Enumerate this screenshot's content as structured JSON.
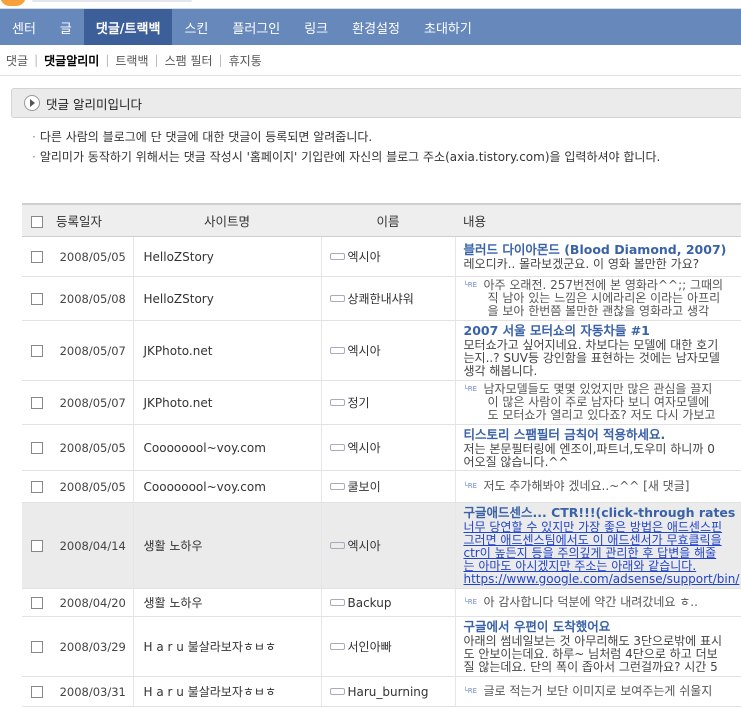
{
  "nav": {
    "main": [
      "센터",
      "글",
      "댓글/트랙백",
      "스킨",
      "플러그인",
      "링크",
      "환경설정",
      "초대하기"
    ],
    "active_main": 2,
    "sub": [
      "댓글",
      "댓글알리미",
      "트랙백",
      "스팸 필터",
      "휴지통"
    ],
    "active_sub": 1
  },
  "page": {
    "title": "댓글 알리미입니다",
    "desc": [
      "다른 사람의 블로그에 단 댓글에 대한 댓글이 등록되면 알려줍니다.",
      "알리미가 동작하기 위해서는 댓글 작성시 '홈페이지' 기입란에 자신의 블로그 주소(axia.tistory.com)을 입력하셔야 합니다."
    ]
  },
  "table": {
    "headers": {
      "date": "등록일자",
      "site": "사이트명",
      "name": "이름",
      "content": "내용"
    },
    "rows": [
      {
        "date": "2008/05/05",
        "site": "HelloZStory",
        "name": "엑시아",
        "kind": "post",
        "title": "블러드 다이아몬드 (Blood Diamond, 2007)",
        "body": [
          "레오디카.. 몰라보겠군요. 이 영화 볼만한 가요?"
        ],
        "h": 40
      },
      {
        "date": "2008/05/08",
        "site": "HelloZStory",
        "name": "상쾌한내샤워",
        "kind": "reply",
        "body": [
          "아주 오래전. 257번전에 본 영화라^^;; 그때의",
          "직 남아 있는 느낌은 시에라리온 이라는 아프리",
          "을 보아 한번쯤 볼만한 괜찮을 영화라고 생각"
        ],
        "h": 44
      },
      {
        "date": "2008/05/07",
        "site": "JKPhoto.net",
        "name": "엑시아",
        "kind": "post",
        "title": "2007 서울 모터쇼의 자동차들 #1",
        "body": [
          "모터쇼가고 싶어지네요. 차보다는 모델에 대한 호기",
          "는지..? SUV등 강인함을 표현하는 것에는 남자모델",
          "생각 해봅니다."
        ],
        "h": 60
      },
      {
        "date": "2008/05/07",
        "site": "JKPhoto.net",
        "name": "정기",
        "kind": "reply",
        "body": [
          "남자모델들도 몇몇 있었지만 많은 관심을 끌지",
          "이 많은 사람이 주로 남자다 보니 여자모델에",
          "도 모터쇼가 열리고 있다죠? 저도 다시 가보고"
        ],
        "h": 44
      },
      {
        "date": "2008/05/05",
        "site": "Coooooool~voy.com",
        "name": "엑시아",
        "kind": "post",
        "title": "티스토리 스팸필터 금칙어 적용하세요.",
        "body": [
          "저는 본문필터링에 엔조이,파트너,도우미 하니까 0",
          "어오질 않습니다.^^"
        ],
        "h": 46
      },
      {
        "date": "2008/05/05",
        "site": "Coooooool~voy.com",
        "name": "쿨보이",
        "kind": "reply",
        "body": [
          "저도 추가해봐야 겠네요..~^^ [새 댓글]"
        ],
        "h": 32
      },
      {
        "date": "2008/04/14",
        "site": "생활 노하우",
        "name": "엑시아",
        "kind": "post",
        "hl": true,
        "title": "구글애드센스... CTR!!!(click-through rates",
        "body": [
          "너무 당연할 수 있지만 가장 좋은 방법은 애드센스핀",
          "그러면 애드센스팀에서도 이 애드센서가 무효클릭을",
          "ctr이 높든지 등을 주의깊게 관리한 후 답변을 해줄",
          "는 아마도 아시겠지만 주소는 아래와 같습니다.",
          "https://www.google.com/adsense/support/bin/"
        ],
        "h": 86
      },
      {
        "date": "2008/04/20",
        "site": "생활 노하우",
        "name": "Backup",
        "kind": "reply",
        "body": [
          "아 감사합니다 덕분에 약간 내려갔네요 ㅎ.."
        ],
        "h": 28
      },
      {
        "date": "2008/03/29",
        "site": "H a r u 불살라보자ㅎㅂㅎ",
        "name": "서인아빠",
        "kind": "post",
        "title": "구글에서 우편이 도착했어요",
        "body": [
          "아래의 썸네일보는 것 아무리해도 3단으로밖에 표시",
          "도 안보이는데요. 하루~ 님처럼 4단으로 하고 더보",
          "질 않는데요. 단의 폭이 좁아서 그런걸까요? 시간 5"
        ],
        "h": 60
      },
      {
        "date": "2008/03/31",
        "site": "H a r u 불살라보자ㅎㅂㅎ",
        "name": "Haru_burning",
        "kind": "reply",
        "body": [
          "글로 적는거 보단 이미지로 보여주는게 쉬울지"
        ],
        "h": 30
      }
    ]
  }
}
